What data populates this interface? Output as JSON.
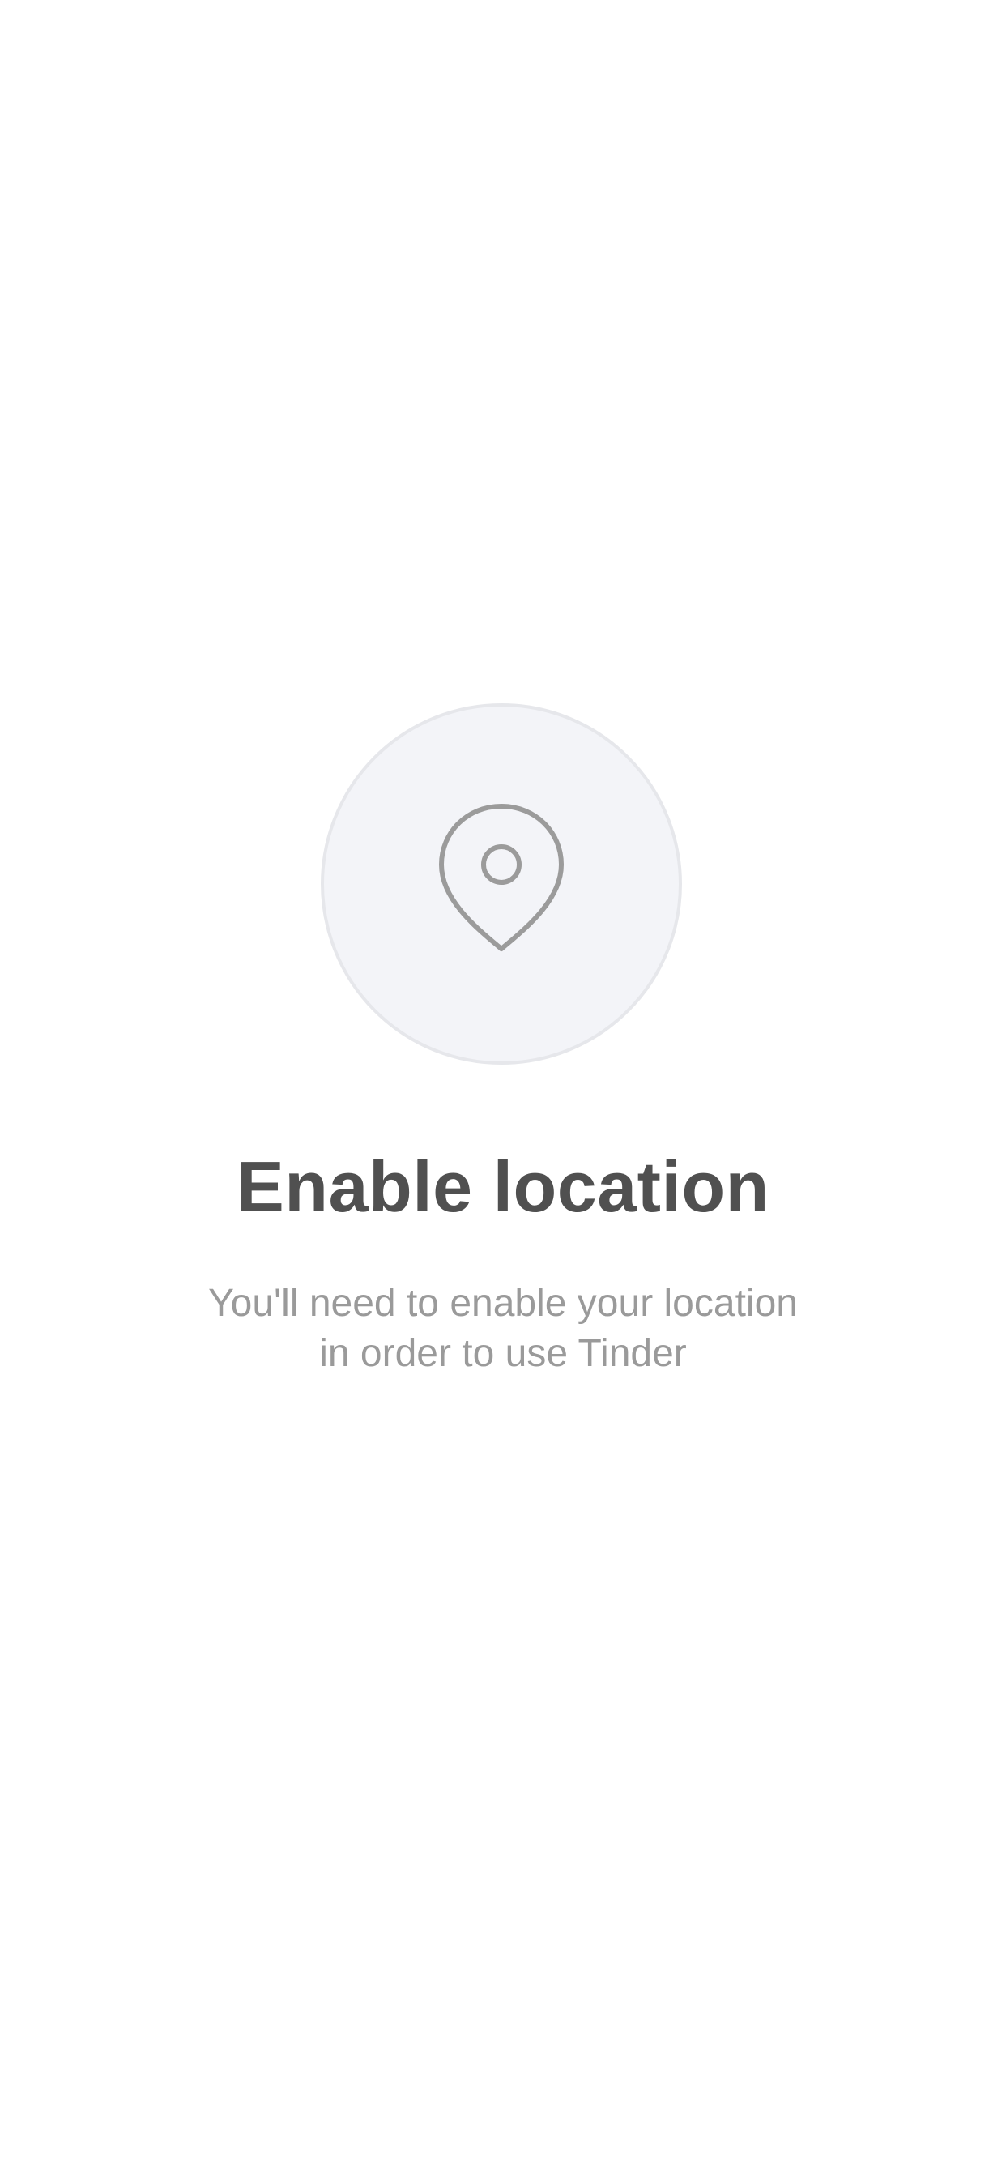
{
  "screen": {
    "icon": "location-pin-icon",
    "title": "Enable location",
    "subtitle_lines": [
      "You'll need to enable your location",
      "in order to use Tinder"
    ]
  },
  "colors": {
    "background": "#ffffff",
    "circle_fill": "#f3f4f8",
    "circle_border": "#e6e7eb",
    "icon_stroke": "#9b9b9b",
    "title": "#505050",
    "subtitle": "#9a9a9a"
  }
}
